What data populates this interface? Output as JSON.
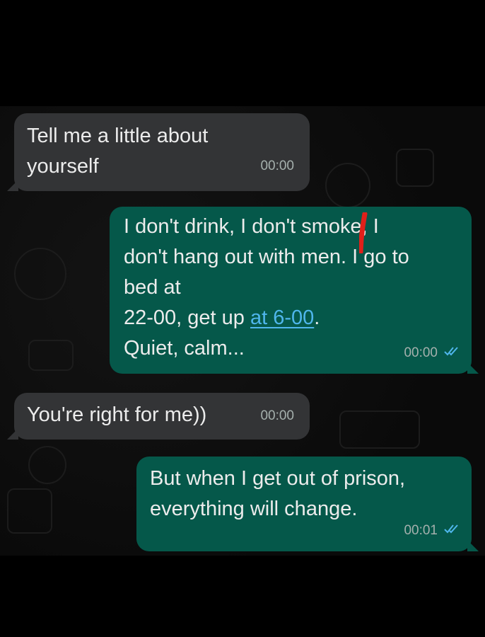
{
  "messages": [
    {
      "direction": "incoming",
      "lines": [
        "Tell me a little about",
        "yourself"
      ],
      "time": "00:00"
    },
    {
      "direction": "outgoing",
      "lines": [
        "I don't drink, I don't smoke, I",
        "don't hang out with men. I go to",
        "bed at"
      ],
      "line4_prefix": "22-00, get up ",
      "line4_link": "at 6-00",
      "line4_suffix": ".",
      "line5": "Quiet, calm...",
      "time": "00:00",
      "status": "read"
    },
    {
      "direction": "incoming",
      "lines": [
        "You're right for me))"
      ],
      "time": "00:00"
    },
    {
      "direction": "outgoing",
      "lines": [
        "But when I get out of prison,",
        "everything will change."
      ],
      "time": "00:01",
      "status": "read"
    }
  ],
  "colors": {
    "incoming_bubble": "#333436",
    "outgoing_bubble": "#05584a",
    "read_ticks": "#4fb6ec",
    "link": "#4fb6ec",
    "annotation_mark": "#e0201a"
  },
  "icons": [
    "double-check-icon",
    "red-marker-annotation"
  ]
}
